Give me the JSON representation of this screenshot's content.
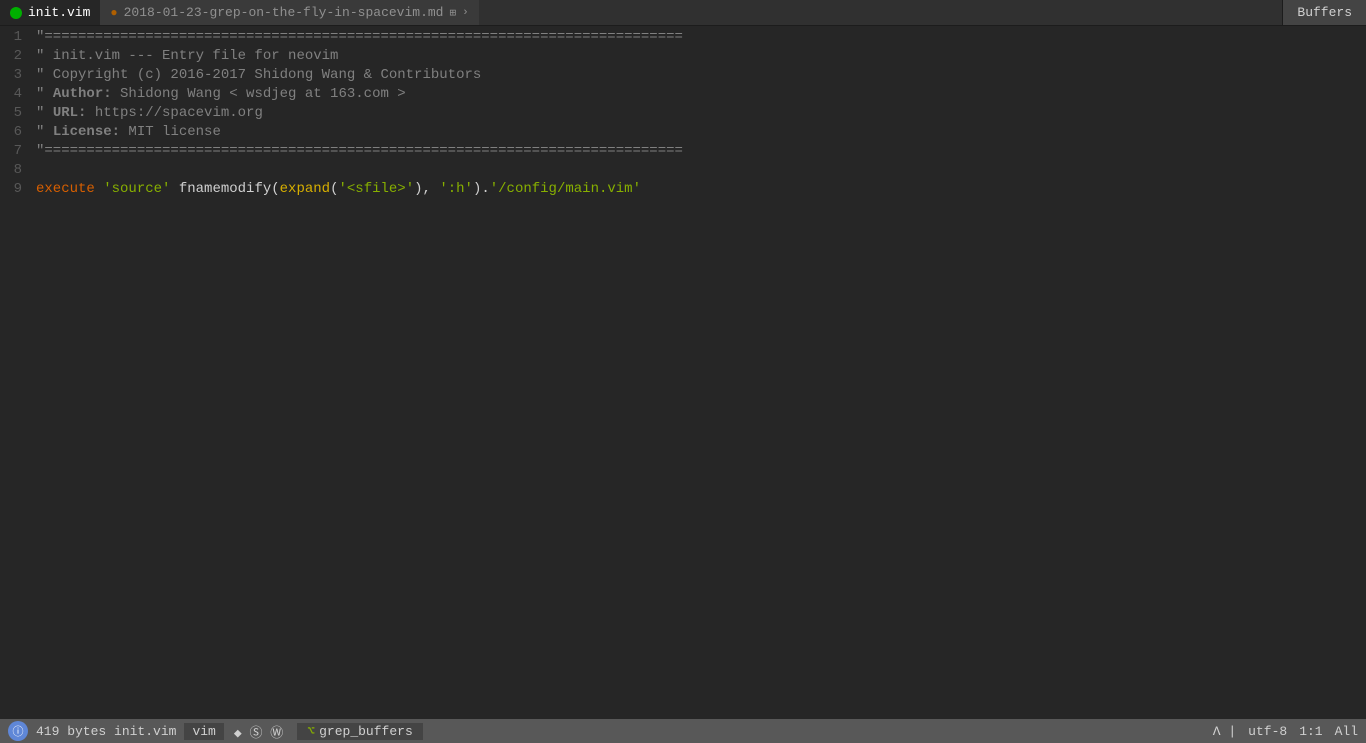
{
  "tabBar": {
    "tabs": [
      {
        "id": "init-vim",
        "label": "init.vim",
        "iconType": "vim-green",
        "active": true,
        "modified": false
      },
      {
        "id": "blog-md",
        "label": "2018-01-23-grep-on-the-fly-in-spacevim.md",
        "iconType": "md",
        "active": false,
        "modified": true,
        "modifiedSymbol": "●"
      }
    ],
    "buffersLabel": "Buffers"
  },
  "editor": {
    "lines": [
      {
        "num": "1",
        "current": false,
        "segments": [
          {
            "text": "\"",
            "style": "equals-line"
          },
          {
            "text": "============================================================================",
            "style": "equals-line"
          }
        ]
      },
      {
        "num": "2",
        "current": false,
        "segments": [
          {
            "text": "\" init.vim --- Entry file for neovim",
            "style": "comment"
          }
        ]
      },
      {
        "num": "3",
        "current": false,
        "segments": [
          {
            "text": "\" ",
            "style": "comment"
          },
          {
            "text": "Copyright",
            "style": "comment"
          },
          {
            "text": " (c) 2016-2017 Shidong Wang & Contributors",
            "style": "comment"
          }
        ]
      },
      {
        "num": "4",
        "current": false,
        "segments": [
          {
            "text": "\" ",
            "style": "comment"
          },
          {
            "text": "Author:",
            "style": "comment-bold"
          },
          {
            "text": " Shidong Wang < wsdjeg at 163.com >",
            "style": "comment"
          }
        ]
      },
      {
        "num": "5",
        "current": false,
        "segments": [
          {
            "text": "\" ",
            "style": "comment"
          },
          {
            "text": "URL:",
            "style": "comment-bold"
          },
          {
            "text": " https://spacevim.org",
            "style": "comment"
          }
        ]
      },
      {
        "num": "6",
        "current": false,
        "segments": [
          {
            "text": "\" ",
            "style": "comment"
          },
          {
            "text": "License:",
            "style": "comment-bold"
          },
          {
            "text": " MIT license",
            "style": "comment"
          }
        ]
      },
      {
        "num": "7",
        "current": false,
        "segments": [
          {
            "text": "\"",
            "style": "equals-line"
          },
          {
            "text": "============================================================================",
            "style": "equals-line"
          }
        ]
      },
      {
        "num": "8",
        "current": false,
        "segments": []
      },
      {
        "num": "9",
        "current": false,
        "segments": [
          {
            "text": "execute",
            "style": "keyword-execute"
          },
          {
            "text": " ",
            "style": "normal"
          },
          {
            "text": "'source'",
            "style": "keyword-string"
          },
          {
            "text": " fnamemodify(",
            "style": "normal"
          },
          {
            "text": "expand",
            "style": "keyword-expand"
          },
          {
            "text": "(",
            "style": "normal"
          },
          {
            "text": "'<sfile>'",
            "style": "keyword-string"
          },
          {
            "text": "), ",
            "style": "normal"
          },
          {
            "text": "':h'",
            "style": "keyword-string"
          },
          {
            "text": ").",
            "style": "normal"
          },
          {
            "text": "'/config/main.vim'",
            "style": "keyword-string"
          }
        ]
      }
    ]
  },
  "statusBar": {
    "indicatorSymbol": "ⓘ",
    "fileSize": "419 bytes",
    "fileName": "init.vim",
    "mode": "vim",
    "spaceSymbol": "◆",
    "sSymbol": "Ⓢ",
    "wSymbol": "Ⓦ",
    "pluginIcon": "⌥",
    "pluginName": "grep_buffers",
    "vimIcon": "Ʌ",
    "encoding": "utf-8",
    "position": "1:1",
    "percent": "All"
  }
}
